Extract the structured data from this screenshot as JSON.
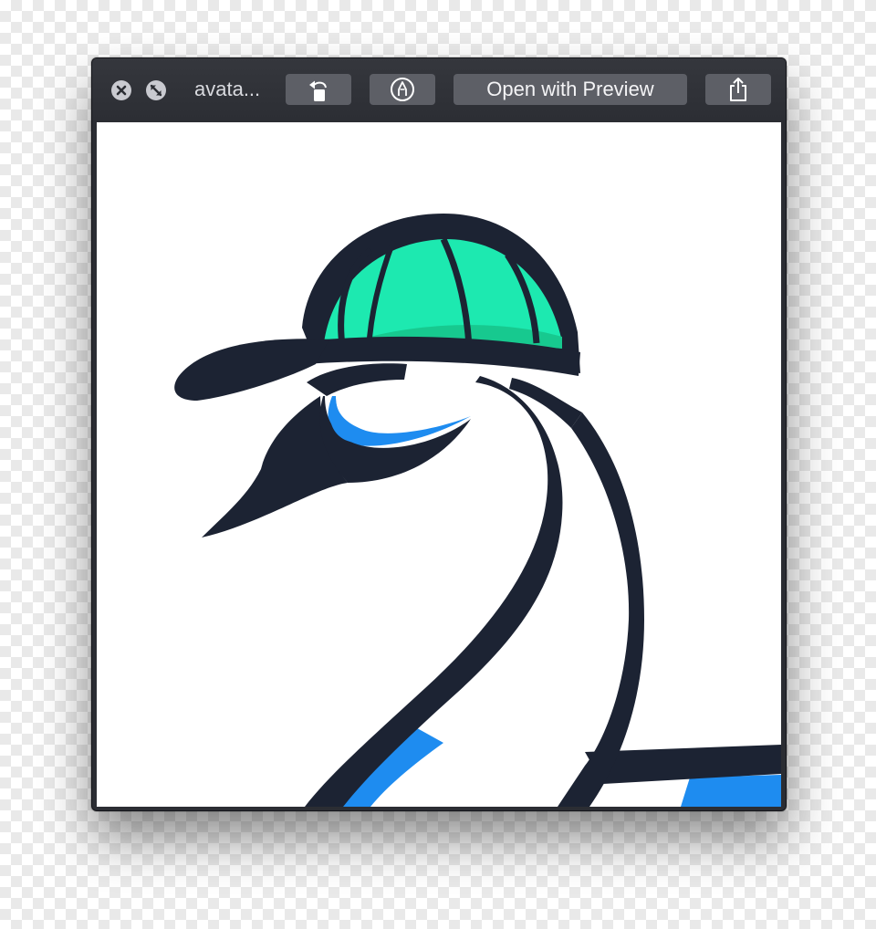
{
  "window": {
    "title": "avata...",
    "buttons": {
      "close_icon": "close-x-icon",
      "fullscreen_icon": "fullscreen-arrows-icon",
      "rotate_icon": "rotate-left-icon",
      "markup_icon": "markup-pen-icon",
      "open_label": "Open with Preview",
      "share_icon": "share-icon"
    }
  },
  "preview": {
    "image": "goose mascot wearing a green baseball cap",
    "colors": {
      "outline": "#1c2333",
      "cap": "#1de9b0",
      "cap_shade": "#17c98f",
      "accent": "#1e8cf0",
      "background": "#ffffff"
    }
  }
}
